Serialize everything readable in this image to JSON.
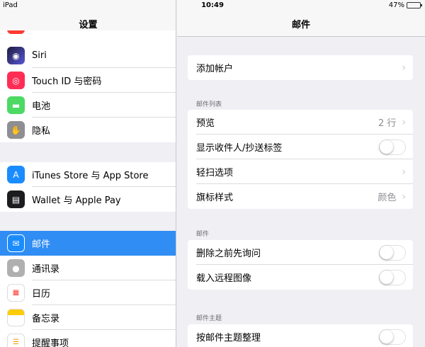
{
  "status": {
    "device": "iPad",
    "time": "10:49",
    "battery": "47%",
    "battery_level": 0.47
  },
  "sidebar": {
    "title": "设置",
    "group1": [
      {
        "label": "Siri",
        "icon": "siri-icon",
        "color": "#2c2c54"
      },
      {
        "label": "Touch ID 与密码",
        "icon": "fingerprint-icon",
        "color": "#ff2d55"
      },
      {
        "label": "电池",
        "icon": "battery-icon",
        "color": "#4cd964"
      },
      {
        "label": "隐私",
        "icon": "hand-icon",
        "color": "#8e8e93"
      }
    ],
    "group2": [
      {
        "label": "iTunes Store 与 App Store",
        "icon": "app-store-icon",
        "color": "#1a8cff"
      },
      {
        "label": "Wallet 与 Apple Pay",
        "icon": "wallet-icon",
        "color": "#1c1c1e"
      }
    ],
    "group3": [
      {
        "label": "邮件",
        "icon": "mail-icon",
        "color": "#1a8cff",
        "selected": true
      },
      {
        "label": "通讯录",
        "icon": "contacts-icon",
        "color": "#b0b0b0"
      },
      {
        "label": "日历",
        "icon": "calendar-icon",
        "color": "#ffffff"
      },
      {
        "label": "备忘录",
        "icon": "notes-icon",
        "color": "#ffcc00"
      },
      {
        "label": "提醒事项",
        "icon": "reminders-icon",
        "color": "#ffffff"
      }
    ]
  },
  "main": {
    "title": "邮件",
    "add_account": "添加帐户",
    "section_list": "邮件列表",
    "preview_label": "预览",
    "preview_value": "2 行",
    "show_to_cc_label": "显示收件人/抄送标签",
    "swipe_label": "轻扫选项",
    "flag_label": "旗标样式",
    "flag_value": "颜色",
    "section_messages": "邮件",
    "ask_delete_label": "删除之前先询问",
    "load_images_label": "载入远程图像",
    "section_threading": "邮件主题",
    "organize_thread_label": "按邮件主题整理"
  },
  "colors": {
    "accent": "#2f8df3",
    "background": "#efeff4"
  }
}
